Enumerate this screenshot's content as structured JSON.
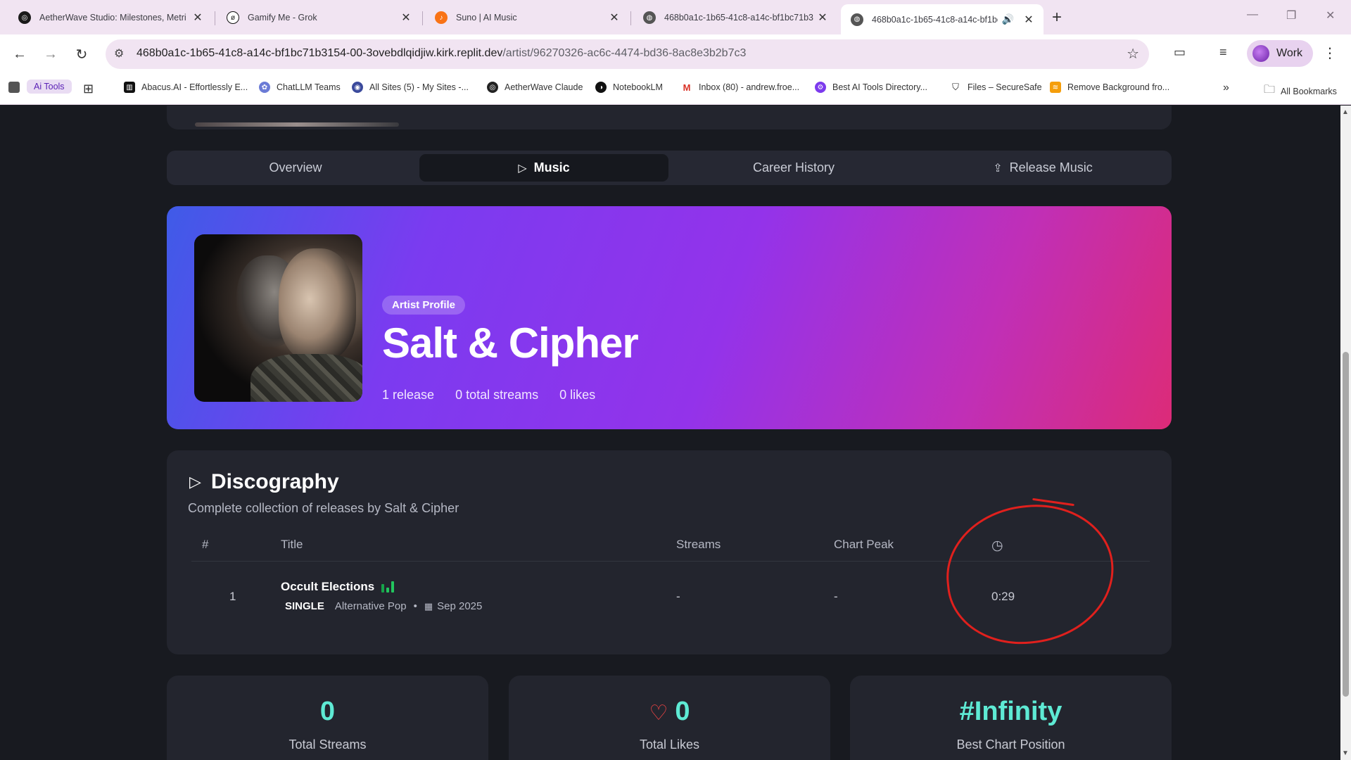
{
  "browser": {
    "tabs": [
      {
        "title": "AetherWave Studio: Milestones, Metri",
        "icon": "aetherwave-icon",
        "active": false
      },
      {
        "title": "Gamify Me - Grok",
        "icon": "grok-icon",
        "active": false
      },
      {
        "title": "Suno | AI Music",
        "icon": "suno-icon",
        "active": false
      },
      {
        "title": "468b0a1c-1b65-41c8-a14c-bf1bc71b3",
        "icon": "globe-icon",
        "active": false
      },
      {
        "title": "468b0a1c-1b65-41c8-a14c-bf1bc",
        "icon": "globe-icon",
        "active": true
      }
    ],
    "url_host": "468b0a1c-1b65-41c8-a14c-bf1bc71b3154-00-3ovebdlqidjiw.kirk.replit.dev",
    "url_path": "/artist/96270326-ac6c-4474-bd36-8ac8e3b2b7c3",
    "profile_label": "Work",
    "bookmarks": [
      {
        "label": "Ai Tools",
        "icon": "folder-icon"
      },
      {
        "label": "Abacus.AI - Effortlessly E...",
        "icon": "abacus-icon"
      },
      {
        "label": "ChatLLM Teams",
        "icon": "chatllm-icon"
      },
      {
        "label": "All Sites (5) - My Sites -...",
        "icon": "sites-icon"
      },
      {
        "label": "AetherWave Claude",
        "icon": "aetherwave-icon"
      },
      {
        "label": "NotebookLM",
        "icon": "notebooklm-icon"
      },
      {
        "label": "Inbox (80) - andrew.froe...",
        "icon": "gmail-icon"
      },
      {
        "label": "Best AI Tools Directory...",
        "icon": "gear-icon"
      },
      {
        "label": "Files – SecureSafe",
        "icon": "shield-icon"
      },
      {
        "label": "Remove Background fro...",
        "icon": "layers-icon"
      }
    ],
    "all_bookmarks_label": "All Bookmarks"
  },
  "nav_tabs": {
    "overview": "Overview",
    "music": "Music",
    "career": "Career History",
    "release": "Release Music"
  },
  "artist": {
    "badge": "Artist Profile",
    "name": "Salt & Cipher",
    "releases": "1 release",
    "streams": "0 total streams",
    "likes": "0 likes"
  },
  "discography": {
    "title": "Discography",
    "subtitle": "Complete collection of releases by Salt & Cipher",
    "columns": {
      "num": "#",
      "title": "Title",
      "streams": "Streams",
      "peak": "Chart Peak",
      "duration_icon": "clock-icon"
    },
    "rows": [
      {
        "num": "1",
        "title": "Occult Elections",
        "type": "SINGLE",
        "genre": "Alternative Pop",
        "date": "Sep 2025",
        "streams": "-",
        "peak": "-",
        "duration": "0:29"
      }
    ]
  },
  "stats": {
    "streams_value": "0",
    "streams_label": "Total Streams",
    "likes_value": "0",
    "likes_label": "Total Likes",
    "chart_value": "#Infinity",
    "chart_label": "Best Chart Position"
  },
  "colors": {
    "accent_teal": "#5eead4",
    "annotation_red": "#e0201d",
    "hero_gradient_start": "#3f5be8",
    "hero_gradient_end": "#dc2b78"
  }
}
